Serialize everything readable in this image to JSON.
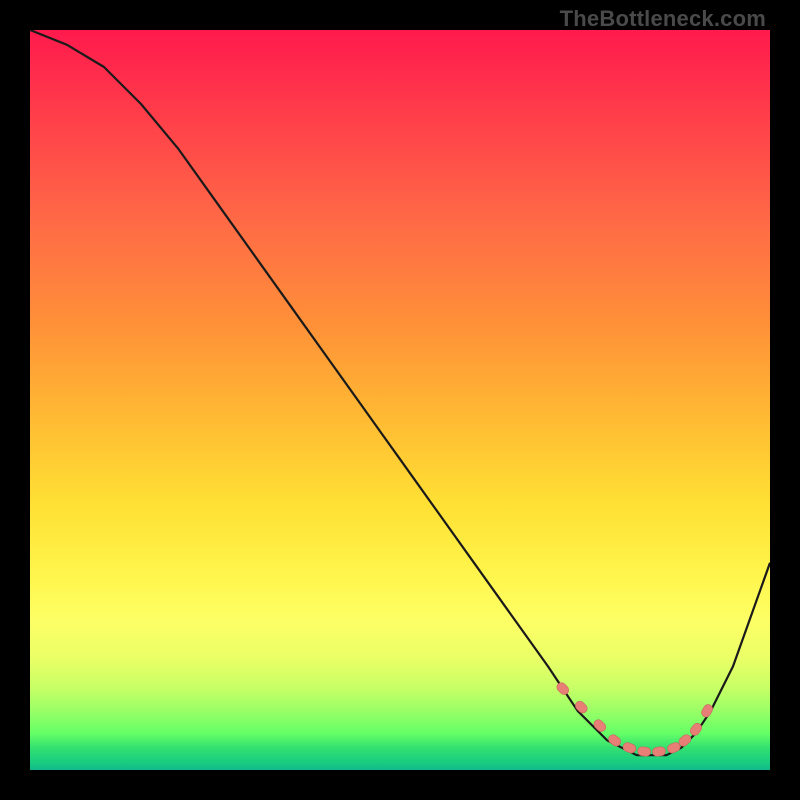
{
  "watermark": "TheBottleneck.com",
  "colors": {
    "frame": "#000000",
    "curve_stroke": "#1a1a1a",
    "marker_fill": "#e77f76",
    "marker_stroke": "#c9655d"
  },
  "chart_data": {
    "type": "line",
    "title": "",
    "xlabel": "",
    "ylabel": "",
    "xlim": [
      0,
      100
    ],
    "ylim": [
      0,
      100
    ],
    "grid": false,
    "series": [
      {
        "name": "bottleneck-curve",
        "x": [
          0,
          5,
          10,
          15,
          20,
          25,
          30,
          35,
          40,
          45,
          50,
          55,
          60,
          65,
          70,
          72,
          74,
          76,
          78,
          80,
          82,
          84,
          86,
          88,
          90,
          92,
          95,
          100
        ],
        "values": [
          100,
          98,
          95,
          90,
          84,
          77,
          70,
          63,
          56,
          49,
          42,
          35,
          28,
          21,
          14,
          11,
          8,
          6,
          4,
          3,
          2,
          2,
          2,
          3,
          5,
          8,
          14,
          28
        ]
      }
    ],
    "markers": {
      "name": "optimal-zone",
      "x": [
        72,
        74.5,
        77,
        79,
        81,
        83,
        85,
        87,
        88.5,
        90,
        91.5
      ],
      "values": [
        11,
        8.5,
        6,
        4,
        3,
        2.5,
        2.5,
        3,
        4,
        5.5,
        8
      ],
      "style": "dashed-pill"
    }
  }
}
